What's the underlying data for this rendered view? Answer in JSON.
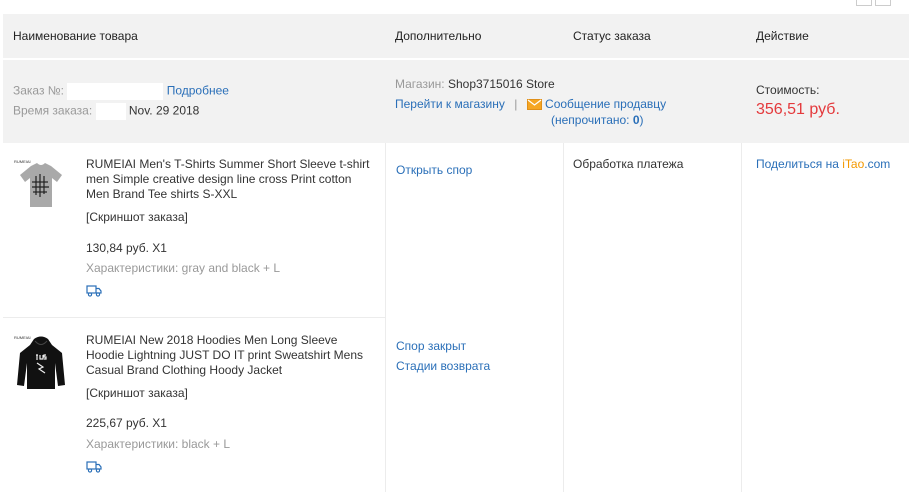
{
  "header": {
    "col_product": "Наименование товара",
    "col_extra": "Дополнительно",
    "col_status": "Статус заказа",
    "col_action": "Действие"
  },
  "order": {
    "number_label": "Заказ №:",
    "details_link": "Подробнее",
    "time_label": "Время заказа:",
    "date": "Nov. 29 2018",
    "store_label": "Магазин:",
    "store_name": "Shop3715016 Store",
    "goto_store": "Перейти к магазину",
    "separator": "|",
    "message_seller": "Сообщение продавцу",
    "unread_prefix": "(непрочитано: ",
    "unread_count": "0",
    "unread_suffix": ")",
    "cost_label": "Стоимость:",
    "cost_value": "356,51 руб.",
    "status": "Обработка платежа",
    "share_prefix": "Поделиться на ",
    "share_brand_a": "iTao",
    "share_brand_b": ".com"
  },
  "items": [
    {
      "title_1": "RUMEIAI Men's T-Shirts Summer Short Sleeve t-shirt",
      "title_2": "men Simple creative design line cross Print cotton",
      "title_3": "Men Brand Tee shirts S-XXL",
      "screenshot": "[Скриншот заказа]",
      "price": "130,84 руб. X1",
      "props": "Характеристики: gray and black + L",
      "action": "Открыть спор",
      "thumb_brand": "RUMEIAI",
      "icon": "truck-icon"
    },
    {
      "title_1": "RUMEIAI New 2018 Hoodies Men Long Sleeve",
      "title_2": "Hoodie Lightning JUST DO IT print Sweatshirt Mens",
      "title_3": "Casual Brand Clothing Hoody Jacket",
      "screenshot": "[Скриншот заказа]",
      "price": "225,67 руб. X1",
      "props": "Характеристики: black + L",
      "action_1": "Спор закрыт",
      "action_2": "Стадии возврата",
      "thumb_brand": "RUMEIAI",
      "icon": "truck-icon"
    }
  ],
  "colors": {
    "link": "#2a6fb8",
    "price": "#e4393c",
    "header_bg": "#f2f2f2",
    "muted": "#999999",
    "mail_icon": "#f5a623"
  }
}
